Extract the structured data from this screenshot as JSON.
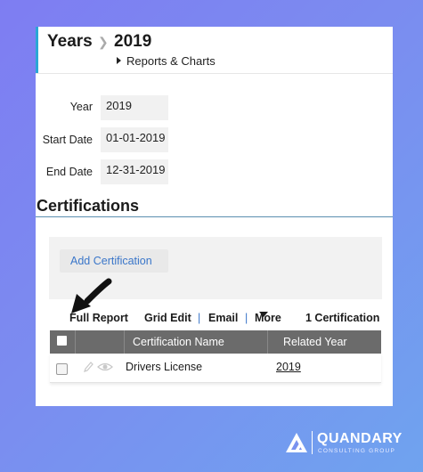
{
  "breadcrumb": {
    "root": "Years",
    "current": "2019"
  },
  "sub_link": "Reports & Charts",
  "fields": [
    {
      "label": "Year",
      "value": "2019"
    },
    {
      "label": "Start Date",
      "value": "01-01-2019"
    },
    {
      "label": "End Date",
      "value": "12-31-2019"
    }
  ],
  "section_title": "Certifications",
  "add_button": "Add Certification",
  "toolbar": {
    "full_report": "Full Report",
    "grid_edit": "Grid Edit",
    "email": "Email",
    "more": "More",
    "count": "1 Certification",
    "separator": "|"
  },
  "grid": {
    "columns": [
      "Certification Name",
      "Related Year"
    ],
    "rows": [
      {
        "name": "Drivers License",
        "year": "2019"
      }
    ]
  },
  "logo": {
    "name": "QUANDARY",
    "tagline": "CONSULTING GROUP"
  },
  "colors": {
    "accent": "#2aa6d6",
    "link": "#3a76c9",
    "grid_header": "#6b6b6b"
  },
  "icons": [
    "caret-right-icon",
    "caret-down-icon",
    "pencil-icon",
    "eye-icon",
    "annotation-arrow-icon",
    "logo-mark-icon"
  ]
}
